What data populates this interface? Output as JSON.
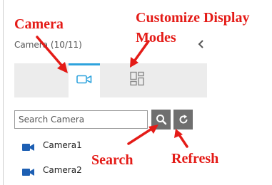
{
  "panel": {
    "title": "Camera (10/11)",
    "collapse_icon": "chevron-left-icon"
  },
  "tabs": [
    {
      "name": "camera",
      "icon": "camera-icon",
      "active": true
    },
    {
      "name": "customize-display-modes",
      "icon": "layout-grid-icon",
      "active": false
    }
  ],
  "search": {
    "placeholder": "Search Camera",
    "value": "",
    "search_icon": "magnifier-icon",
    "refresh_icon": "refresh-icon"
  },
  "cameras": [
    {
      "label": "Camera1",
      "icon": "camera-icon"
    },
    {
      "label": "Camera2",
      "icon": "camera-icon"
    }
  ],
  "annotations": {
    "camera": "Camera",
    "customize_line1": "Customize Display",
    "customize_line2": "Modes",
    "search": "Search",
    "refresh": "Refresh"
  },
  "colors": {
    "accent": "#2ea3dd",
    "annotation_red": "#e41b17",
    "button_gray": "#6f6f6f",
    "camera_icon_blue": "#1d5fb3",
    "tabbar_bg": "#ececec"
  }
}
